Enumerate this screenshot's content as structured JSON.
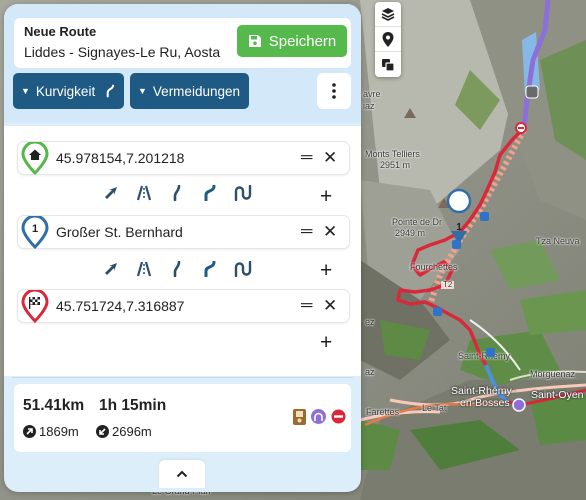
{
  "route": {
    "title": "Neue Route",
    "name": "Liddes - Signayes-Le Ru, Aosta",
    "save_label": "Speichern"
  },
  "options": {
    "curviness_label": "Kurvigkeit",
    "avoid_label": "Vermeidungen"
  },
  "waypoints": [
    {
      "label": "45.978154,7.201218",
      "marker": "home",
      "color": "#52b848"
    },
    {
      "label": "Großer St. Bernhard",
      "marker": "1",
      "color": "#2f6ea8"
    },
    {
      "label": "45.751724,7.316887",
      "marker": "finish",
      "color": "#d9283a"
    }
  ],
  "profiles": [
    "fastest",
    "highway",
    "curvy",
    "extra-curvy",
    "super-curvy"
  ],
  "active_profile": "extra-curvy",
  "summary": {
    "distance": "51.41km",
    "duration": "1h 15min",
    "ascent": "1869m",
    "descent": "2696m"
  },
  "map": {
    "labels": {
      "monts_telliers": "Monts Telliers",
      "monts_telliers_alt": "2951 m",
      "pointe": "Pointe de Dr",
      "pointe_alt": "2949 m",
      "fourchettes": "Fourchettes",
      "tza_neuva": "Tza Neuva",
      "t2": "T2",
      "saint_rhemy": "Saint-Rhémy",
      "saint_rhemy_bosses_1": "Saint-Rhémy-",
      "saint_rhemy_bosses_2": "en-Bosses",
      "saint_oyen": "Saint-Oyen",
      "morgueniaz": "Morguenaz",
      "farettes": "Farettes",
      "le_tat": "Le Tat",
      "le_grand_plan": "Le Grand-Plan",
      "avre": "avre",
      "iaz": "iaz",
      "az": "az",
      "ez": "ez",
      "waypoint_1": "1"
    },
    "route_color": "#d9283a",
    "highway_color": "#8c6fd9"
  },
  "colors": {
    "accent_dark": "#1f5a84",
    "save_green": "#56b94b",
    "panel_bg": "#ddeefb"
  }
}
